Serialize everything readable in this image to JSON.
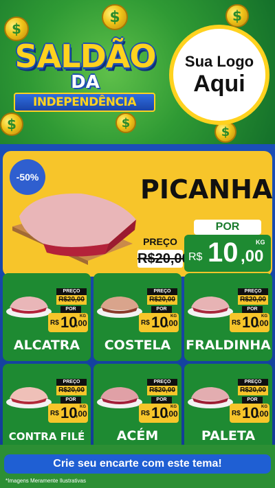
{
  "header": {
    "title_main": "SALDÃO",
    "title_da": "DA",
    "title_ribbon": "INDEPENDÊNCIA",
    "logo_line1": "Sua Logo",
    "logo_line2": "Aqui",
    "coin_symbol": "$"
  },
  "featured": {
    "discount": "-50%",
    "name": "PICANHA",
    "preco_label": "PREÇO",
    "old_price": "R$20,00",
    "por_label": "POR",
    "currency": "R$",
    "price_int": "10",
    "price_cents": ",00",
    "unit": "KG"
  },
  "products": [
    {
      "name": "ALCATRA",
      "preco_label": "PREÇO",
      "old_price": "R$20,00",
      "por_label": "POR",
      "currency": "R$",
      "price_int": "10",
      "price_cents": ",00",
      "unit": "KG"
    },
    {
      "name": "COSTELA",
      "preco_label": "PREÇO",
      "old_price": "R$20,00",
      "por_label": "POR",
      "currency": "R$",
      "price_int": "10",
      "price_cents": ",00",
      "unit": "KG"
    },
    {
      "name": "FRALDINHA",
      "preco_label": "PREÇO",
      "old_price": "R$20,00",
      "por_label": "POR",
      "currency": "R$",
      "price_int": "10",
      "price_cents": ",00",
      "unit": "KG"
    },
    {
      "name": "CONTRA FILÉ",
      "preco_label": "PREÇO",
      "old_price": "R$20,00",
      "por_label": "POR",
      "currency": "R$",
      "price_int": "10",
      "price_cents": ",00",
      "unit": "KG"
    },
    {
      "name": "ACÉM",
      "preco_label": "PREÇO",
      "old_price": "R$20,00",
      "por_label": "POR",
      "currency": "R$",
      "price_int": "10",
      "price_cents": ",00",
      "unit": "KG"
    },
    {
      "name": "PALETA",
      "preco_label": "PREÇO",
      "old_price": "R$20,00",
      "por_label": "POR",
      "currency": "R$",
      "price_int": "10",
      "price_cents": ",00",
      "unit": "KG"
    }
  ],
  "footer": {
    "cta": "Crie seu encarte com este tema!",
    "disclaimer": "*Imagens Meramente Ilustrativas"
  },
  "colors": {
    "green": "#1e8a32",
    "yellow": "#f7c52a",
    "blue": "#1b4fb8",
    "cta_blue": "#1f5fd3"
  }
}
